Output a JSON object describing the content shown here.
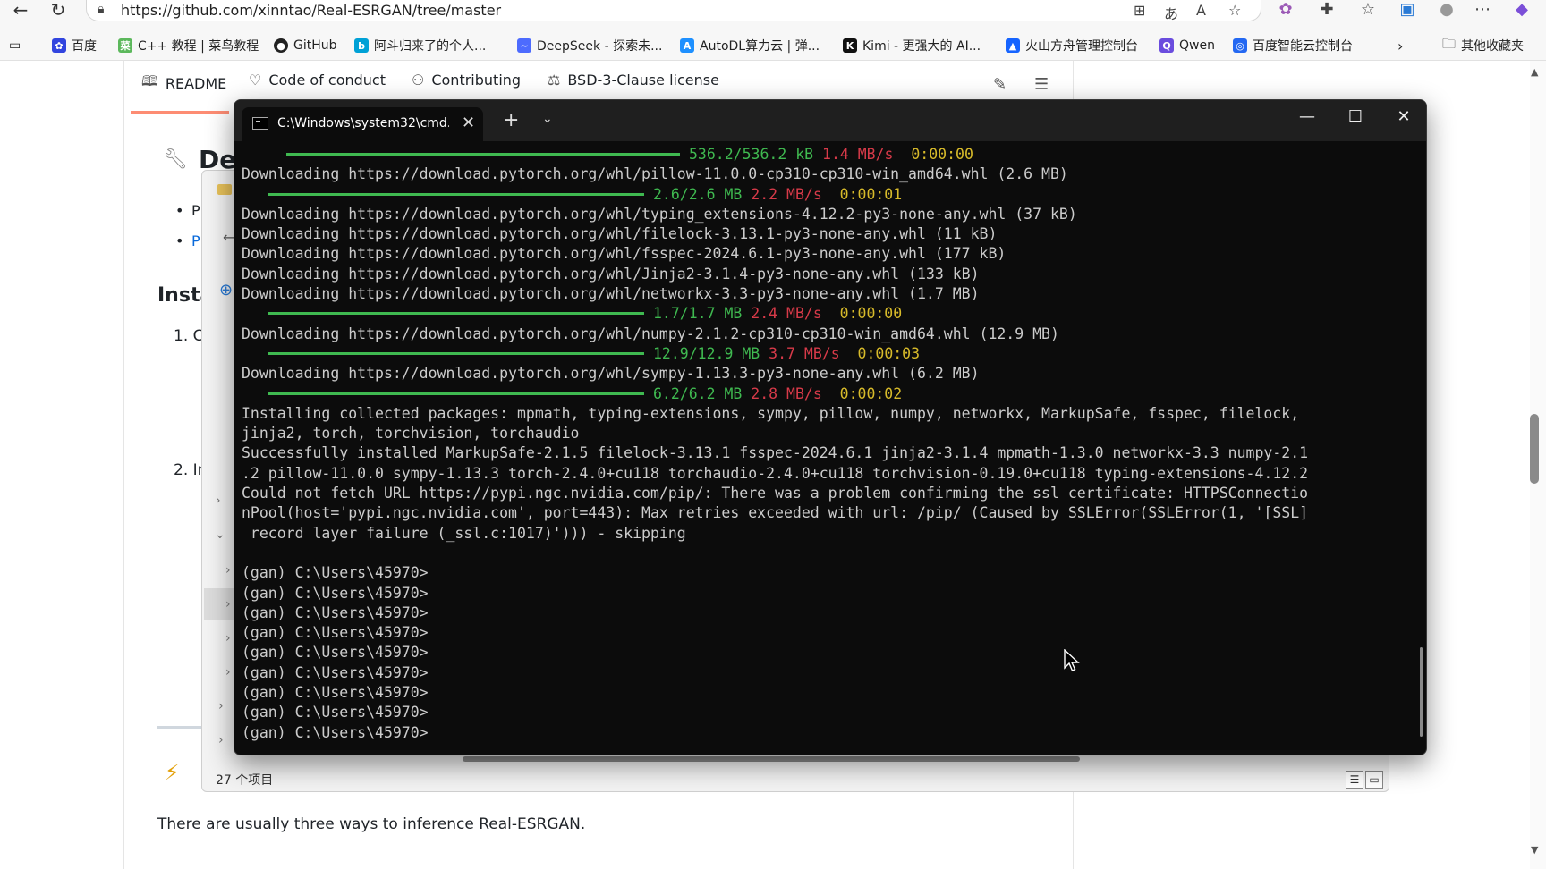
{
  "browser": {
    "url": "https://github.com/xinntao/Real-ESRGAN/tree/master",
    "bookmarks": [
      {
        "label": "百度",
        "icon": "baidu-icon"
      },
      {
        "label": "C++ 教程 | 菜鸟教程",
        "icon": "runoob-icon"
      },
      {
        "label": "GitHub",
        "icon": "github-icon"
      },
      {
        "label": "阿斗归来了的个人...",
        "icon": "bilibili-icon"
      },
      {
        "label": "DeepSeek - 探索未...",
        "icon": "deepseek-icon"
      },
      {
        "label": "AutoDL算力云 | 弹...",
        "icon": "autodl-icon"
      },
      {
        "label": "Kimi - 更强大的 AI...",
        "icon": "kimi-icon"
      },
      {
        "label": "火山方舟管理控制台",
        "icon": "volcano-icon"
      },
      {
        "label": "Qwen",
        "icon": "qwen-icon"
      },
      {
        "label": "百度智能云控制台",
        "icon": "baiducloud-icon"
      }
    ],
    "other_bookmarks": "其他收藏夹"
  },
  "readme_tabs": [
    {
      "label": "README",
      "icon": "book-icon"
    },
    {
      "label": "Code of conduct",
      "icon": "heart-shield-icon"
    },
    {
      "label": "Contributing",
      "icon": "people-icon"
    },
    {
      "label": "BSD-3-Clause license",
      "icon": "scale-icon"
    }
  ],
  "page": {
    "heading_partial": "De",
    "install_partial": "Insta",
    "list_a": "P",
    "list_b": "P",
    "step1": "1. C",
    "step2": "2. Ir",
    "bottom_text": "There are usually three ways to inference Real-ESRGAN."
  },
  "explorer": {
    "status": "27 个项目"
  },
  "terminal": {
    "tab_title": "C:\\Windows\\system32\\cmd.e",
    "lines": [
      {
        "kind": "progress",
        "bar": 440,
        "size": "536.2/536.2 kB",
        "speed": "1.4 MB/s",
        "eta": "0:00:00"
      },
      {
        "kind": "text",
        "text": "Downloading https://download.pytorch.org/whl/pillow-11.0.0-cp310-cp310-win_amd64.whl (2.6 MB)"
      },
      {
        "kind": "progress",
        "bar": 420,
        "size": "2.6/2.6 MB",
        "speed": "2.2 MB/s",
        "eta": "0:00:01"
      },
      {
        "kind": "text",
        "text": "Downloading https://download.pytorch.org/whl/typing_extensions-4.12.2-py3-none-any.whl (37 kB)"
      },
      {
        "kind": "text",
        "text": "Downloading https://download.pytorch.org/whl/filelock-3.13.1-py3-none-any.whl (11 kB)"
      },
      {
        "kind": "text",
        "text": "Downloading https://download.pytorch.org/whl/fsspec-2024.6.1-py3-none-any.whl (177 kB)"
      },
      {
        "kind": "text",
        "text": "Downloading https://download.pytorch.org/whl/Jinja2-3.1.4-py3-none-any.whl (133 kB)"
      },
      {
        "kind": "text",
        "text": "Downloading https://download.pytorch.org/whl/networkx-3.3-py3-none-any.whl (1.7 MB)"
      },
      {
        "kind": "progress",
        "bar": 420,
        "size": "1.7/1.7 MB",
        "speed": "2.4 MB/s",
        "eta": "0:00:00"
      },
      {
        "kind": "text",
        "text": "Downloading https://download.pytorch.org/whl/numpy-2.1.2-cp310-cp310-win_amd64.whl (12.9 MB)"
      },
      {
        "kind": "progress",
        "bar": 420,
        "size": "12.9/12.9 MB",
        "speed": "3.7 MB/s",
        "eta": "0:00:03"
      },
      {
        "kind": "text",
        "text": "Downloading https://download.pytorch.org/whl/sympy-1.13.3-py3-none-any.whl (6.2 MB)"
      },
      {
        "kind": "progress",
        "bar": 420,
        "size": "6.2/6.2 MB",
        "speed": "2.8 MB/s",
        "eta": "0:00:02"
      },
      {
        "kind": "text",
        "text": "Installing collected packages: mpmath, typing-extensions, sympy, pillow, numpy, networkx, MarkupSafe, fsspec, filelock,"
      },
      {
        "kind": "text",
        "text": "jinja2, torch, torchvision, torchaudio"
      },
      {
        "kind": "text",
        "text": "Successfully installed MarkupSafe-2.1.5 filelock-3.13.1 fsspec-2024.6.1 jinja2-3.1.4 mpmath-1.3.0 networkx-3.3 numpy-2.1"
      },
      {
        "kind": "text",
        "text": ".2 pillow-11.0.0 sympy-1.13.3 torch-2.4.0+cu118 torchaudio-2.4.0+cu118 torchvision-0.19.0+cu118 typing-extensions-4.12.2"
      },
      {
        "kind": "text",
        "text": "Could not fetch URL https://pypi.ngc.nvidia.com/pip/: There was a problem confirming the ssl certificate: HTTPSConnectio"
      },
      {
        "kind": "text",
        "text": "nPool(host='pypi.ngc.nvidia.com', port=443): Max retries exceeded with url: /pip/ (Caused by SSLError(SSLError(1, '[SSL]"
      },
      {
        "kind": "text",
        "text": " record layer failure (_ssl.c:1017)'))) - skipping"
      },
      {
        "kind": "text",
        "text": ""
      },
      {
        "kind": "text",
        "text": "(gan) C:\\Users\\45970>"
      },
      {
        "kind": "text",
        "text": "(gan) C:\\Users\\45970>"
      },
      {
        "kind": "text",
        "text": "(gan) C:\\Users\\45970>"
      },
      {
        "kind": "text",
        "text": "(gan) C:\\Users\\45970>"
      },
      {
        "kind": "text",
        "text": "(gan) C:\\Users\\45970>"
      },
      {
        "kind": "text",
        "text": "(gan) C:\\Users\\45970>"
      },
      {
        "kind": "text",
        "text": "(gan) C:\\Users\\45970>"
      },
      {
        "kind": "text",
        "text": "(gan) C:\\Users\\45970>"
      },
      {
        "kind": "text",
        "text": "(gan) C:\\Users\\45970>"
      }
    ]
  }
}
